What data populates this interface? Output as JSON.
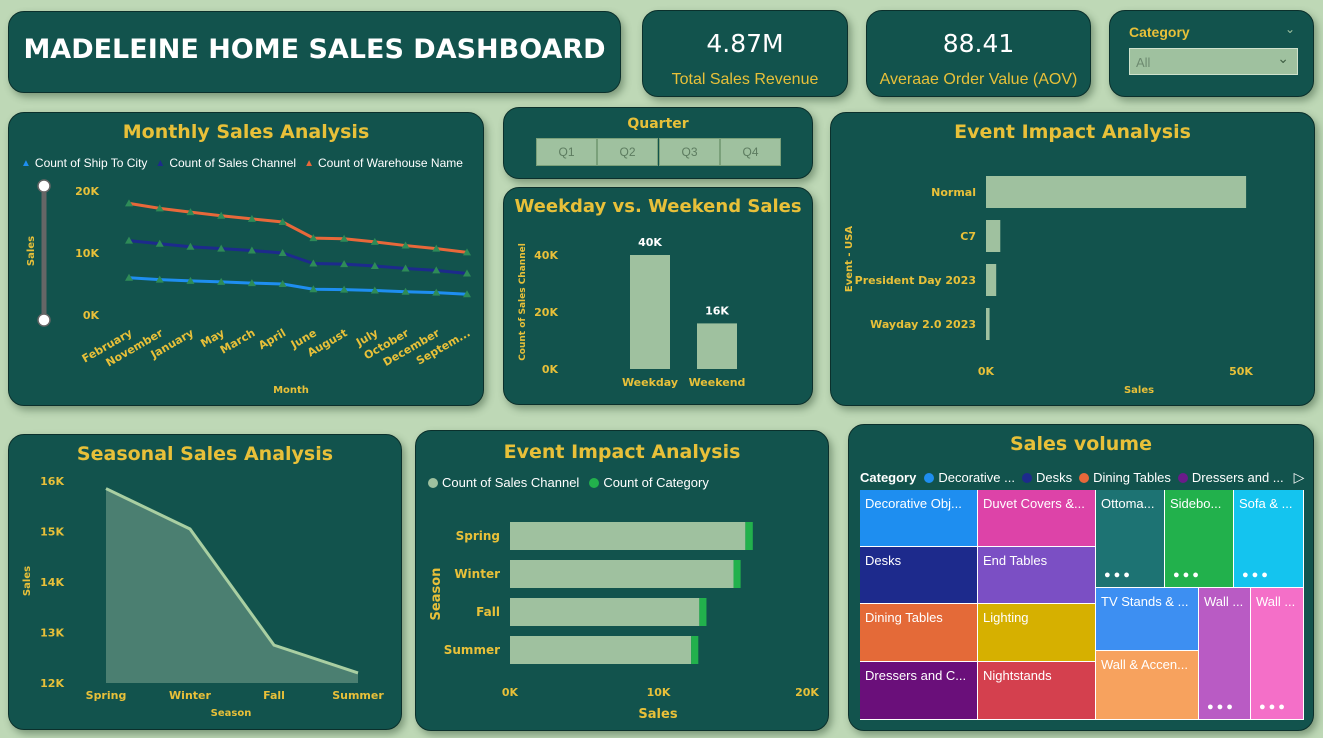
{
  "header": {
    "title": "MADELEINE HOME SALES DASHBOARD"
  },
  "kpis": {
    "revenue": {
      "value": "4.87M",
      "label": "Total Sales Revenue"
    },
    "aov": {
      "value": "88.41",
      "label": "Averaae Order Value (AOV)"
    }
  },
  "category_slicer": {
    "title": "Category",
    "value": "All"
  },
  "quarter_slicer": {
    "title": "Quarter",
    "options": [
      "Q1",
      "Q2",
      "Q3",
      "Q4"
    ]
  },
  "colors": {
    "card": "#12534d",
    "gold": "#e8c039",
    "bar": "#9fc19f",
    "green": "#22b14c"
  },
  "chart_data": [
    {
      "id": "monthly",
      "type": "line",
      "title": "Monthly Sales Analysis",
      "xlabel": "Month",
      "ylabel": "Sales",
      "categories": [
        "February",
        "November",
        "January",
        "May",
        "March",
        "April",
        "June",
        "August",
        "July",
        "October",
        "December",
        "Septem..."
      ],
      "series": [
        {
          "name": "Count of Ship To City",
          "color": "#1e8ef0",
          "values": [
            6000,
            5700,
            5500,
            5350,
            5150,
            5000,
            4150,
            4100,
            3950,
            3750,
            3600,
            3350
          ]
        },
        {
          "name": "Count of Sales Channel",
          "color": "#1d2a8c",
          "values": [
            12000,
            11500,
            11000,
            10700,
            10400,
            10000,
            8300,
            8200,
            7900,
            7500,
            7200,
            6700
          ]
        },
        {
          "name": "Count of Warehouse Name",
          "color": "#e8683a",
          "values": [
            18000,
            17200,
            16600,
            16000,
            15500,
            15000,
            12400,
            12300,
            11800,
            11200,
            10700,
            10100
          ]
        }
      ],
      "yticks": [
        "20K",
        "10K",
        "0K"
      ],
      "ylim": [
        0,
        20000
      ]
    },
    {
      "id": "weekday",
      "type": "bar",
      "title": "Weekday vs. Weekend Sales",
      "ylabel": "Count of Sales Channel",
      "categories": [
        "Weekday",
        "Weekend"
      ],
      "values": [
        40000,
        16000
      ],
      "value_labels": [
        "40K",
        "16K"
      ],
      "yticks": [
        "40K",
        "20K",
        "0K"
      ],
      "ylim": [
        0,
        40000
      ]
    },
    {
      "id": "event_top",
      "type": "bar",
      "orientation": "horizontal",
      "title": "Event Impact Analysis",
      "xlabel": "Sales",
      "ylabel": "Event - USA",
      "categories": [
        "Normal",
        "C7",
        "President Day 2023",
        "Wayday 2.0 2023"
      ],
      "values": [
        51000,
        2800,
        2000,
        700
      ],
      "xticks": [
        "0K",
        "50K"
      ],
      "xlim": [
        0,
        50000
      ]
    },
    {
      "id": "seasonal",
      "type": "area",
      "title": "Seasonal Sales Analysis",
      "xlabel": "Season",
      "ylabel": "Sales",
      "categories": [
        "Spring",
        "Winter",
        "Fall",
        "Summer"
      ],
      "values": [
        15850,
        15050,
        12750,
        12200
      ],
      "yticks": [
        "16K",
        "15K",
        "14K",
        "13K",
        "12K"
      ],
      "ylim": [
        12000,
        16000
      ]
    },
    {
      "id": "event_bottom",
      "type": "bar",
      "orientation": "horizontal",
      "stacked": true,
      "title": "Event Impact Analysis",
      "xlabel": "Sales",
      "ylabel": "Season",
      "categories": [
        "Spring",
        "Winter",
        "Fall",
        "Summer"
      ],
      "series": [
        {
          "name": "Count of Sales Channel",
          "color": "#9fc19f",
          "values": [
            15850,
            15050,
            12750,
            12200
          ]
        },
        {
          "name": "Count of Category",
          "color": "#22b14c",
          "values": [
            500,
            480,
            480,
            480
          ]
        }
      ],
      "xticks": [
        "0K",
        "10K",
        "20K"
      ],
      "xlim": [
        0,
        20000
      ]
    },
    {
      "id": "volume",
      "type": "treemap",
      "title": "Sales volume",
      "legend_title": "Category",
      "legend": [
        {
          "name": "Decorative ...",
          "color": "#1e8ef0"
        },
        {
          "name": "Desks",
          "color": "#1d2a8c"
        },
        {
          "name": "Dining Tables",
          "color": "#e8683a"
        },
        {
          "name": "Dressers and ...",
          "color": "#6a1b8a"
        }
      ],
      "tiles": [
        {
          "label": "Decorative Obj...",
          "color": "#1e8ef0"
        },
        {
          "label": "Desks",
          "color": "#1d2a8c"
        },
        {
          "label": "Dining Tables",
          "color": "#e46a38"
        },
        {
          "label": "Dressers and C...",
          "color": "#6a0f7a"
        },
        {
          "label": "Duvet Covers &...",
          "color": "#dd43a8"
        },
        {
          "label": "End Tables",
          "color": "#7b4fc4"
        },
        {
          "label": "Lighting",
          "color": "#d6b000"
        },
        {
          "label": "Nightstands",
          "color": "#d4404e"
        },
        {
          "label": "Ottoma...",
          "color": "#1d7373"
        },
        {
          "label": "Sidebo...",
          "color": "#22b14c"
        },
        {
          "label": "Sofa & ...",
          "color": "#14c4ef"
        },
        {
          "label": "TV Stands & ...",
          "color": "#3d8ff2"
        },
        {
          "label": "Wall & Accen...",
          "color": "#f7a25e"
        },
        {
          "label": "Wall ...",
          "color": "#b95bc4"
        },
        {
          "label": "Wall ...",
          "color": "#f46fc8"
        }
      ]
    }
  ]
}
